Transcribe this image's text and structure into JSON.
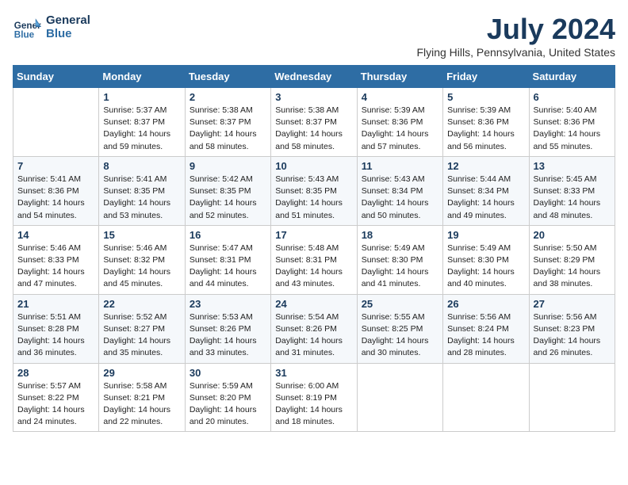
{
  "header": {
    "logo_line1": "General",
    "logo_line2": "Blue",
    "month": "July 2024",
    "location": "Flying Hills, Pennsylvania, United States"
  },
  "weekdays": [
    "Sunday",
    "Monday",
    "Tuesday",
    "Wednesday",
    "Thursday",
    "Friday",
    "Saturday"
  ],
  "weeks": [
    [
      {
        "day": "",
        "info": ""
      },
      {
        "day": "1",
        "info": "Sunrise: 5:37 AM\nSunset: 8:37 PM\nDaylight: 14 hours\nand 59 minutes."
      },
      {
        "day": "2",
        "info": "Sunrise: 5:38 AM\nSunset: 8:37 PM\nDaylight: 14 hours\nand 58 minutes."
      },
      {
        "day": "3",
        "info": "Sunrise: 5:38 AM\nSunset: 8:37 PM\nDaylight: 14 hours\nand 58 minutes."
      },
      {
        "day": "4",
        "info": "Sunrise: 5:39 AM\nSunset: 8:36 PM\nDaylight: 14 hours\nand 57 minutes."
      },
      {
        "day": "5",
        "info": "Sunrise: 5:39 AM\nSunset: 8:36 PM\nDaylight: 14 hours\nand 56 minutes."
      },
      {
        "day": "6",
        "info": "Sunrise: 5:40 AM\nSunset: 8:36 PM\nDaylight: 14 hours\nand 55 minutes."
      }
    ],
    [
      {
        "day": "7",
        "info": "Sunrise: 5:41 AM\nSunset: 8:36 PM\nDaylight: 14 hours\nand 54 minutes."
      },
      {
        "day": "8",
        "info": "Sunrise: 5:41 AM\nSunset: 8:35 PM\nDaylight: 14 hours\nand 53 minutes."
      },
      {
        "day": "9",
        "info": "Sunrise: 5:42 AM\nSunset: 8:35 PM\nDaylight: 14 hours\nand 52 minutes."
      },
      {
        "day": "10",
        "info": "Sunrise: 5:43 AM\nSunset: 8:35 PM\nDaylight: 14 hours\nand 51 minutes."
      },
      {
        "day": "11",
        "info": "Sunrise: 5:43 AM\nSunset: 8:34 PM\nDaylight: 14 hours\nand 50 minutes."
      },
      {
        "day": "12",
        "info": "Sunrise: 5:44 AM\nSunset: 8:34 PM\nDaylight: 14 hours\nand 49 minutes."
      },
      {
        "day": "13",
        "info": "Sunrise: 5:45 AM\nSunset: 8:33 PM\nDaylight: 14 hours\nand 48 minutes."
      }
    ],
    [
      {
        "day": "14",
        "info": "Sunrise: 5:46 AM\nSunset: 8:33 PM\nDaylight: 14 hours\nand 47 minutes."
      },
      {
        "day": "15",
        "info": "Sunrise: 5:46 AM\nSunset: 8:32 PM\nDaylight: 14 hours\nand 45 minutes."
      },
      {
        "day": "16",
        "info": "Sunrise: 5:47 AM\nSunset: 8:31 PM\nDaylight: 14 hours\nand 44 minutes."
      },
      {
        "day": "17",
        "info": "Sunrise: 5:48 AM\nSunset: 8:31 PM\nDaylight: 14 hours\nand 43 minutes."
      },
      {
        "day": "18",
        "info": "Sunrise: 5:49 AM\nSunset: 8:30 PM\nDaylight: 14 hours\nand 41 minutes."
      },
      {
        "day": "19",
        "info": "Sunrise: 5:49 AM\nSunset: 8:30 PM\nDaylight: 14 hours\nand 40 minutes."
      },
      {
        "day": "20",
        "info": "Sunrise: 5:50 AM\nSunset: 8:29 PM\nDaylight: 14 hours\nand 38 minutes."
      }
    ],
    [
      {
        "day": "21",
        "info": "Sunrise: 5:51 AM\nSunset: 8:28 PM\nDaylight: 14 hours\nand 36 minutes."
      },
      {
        "day": "22",
        "info": "Sunrise: 5:52 AM\nSunset: 8:27 PM\nDaylight: 14 hours\nand 35 minutes."
      },
      {
        "day": "23",
        "info": "Sunrise: 5:53 AM\nSunset: 8:26 PM\nDaylight: 14 hours\nand 33 minutes."
      },
      {
        "day": "24",
        "info": "Sunrise: 5:54 AM\nSunset: 8:26 PM\nDaylight: 14 hours\nand 31 minutes."
      },
      {
        "day": "25",
        "info": "Sunrise: 5:55 AM\nSunset: 8:25 PM\nDaylight: 14 hours\nand 30 minutes."
      },
      {
        "day": "26",
        "info": "Sunrise: 5:56 AM\nSunset: 8:24 PM\nDaylight: 14 hours\nand 28 minutes."
      },
      {
        "day": "27",
        "info": "Sunrise: 5:56 AM\nSunset: 8:23 PM\nDaylight: 14 hours\nand 26 minutes."
      }
    ],
    [
      {
        "day": "28",
        "info": "Sunrise: 5:57 AM\nSunset: 8:22 PM\nDaylight: 14 hours\nand 24 minutes."
      },
      {
        "day": "29",
        "info": "Sunrise: 5:58 AM\nSunset: 8:21 PM\nDaylight: 14 hours\nand 22 minutes."
      },
      {
        "day": "30",
        "info": "Sunrise: 5:59 AM\nSunset: 8:20 PM\nDaylight: 14 hours\nand 20 minutes."
      },
      {
        "day": "31",
        "info": "Sunrise: 6:00 AM\nSunset: 8:19 PM\nDaylight: 14 hours\nand 18 minutes."
      },
      {
        "day": "",
        "info": ""
      },
      {
        "day": "",
        "info": ""
      },
      {
        "day": "",
        "info": ""
      }
    ]
  ]
}
